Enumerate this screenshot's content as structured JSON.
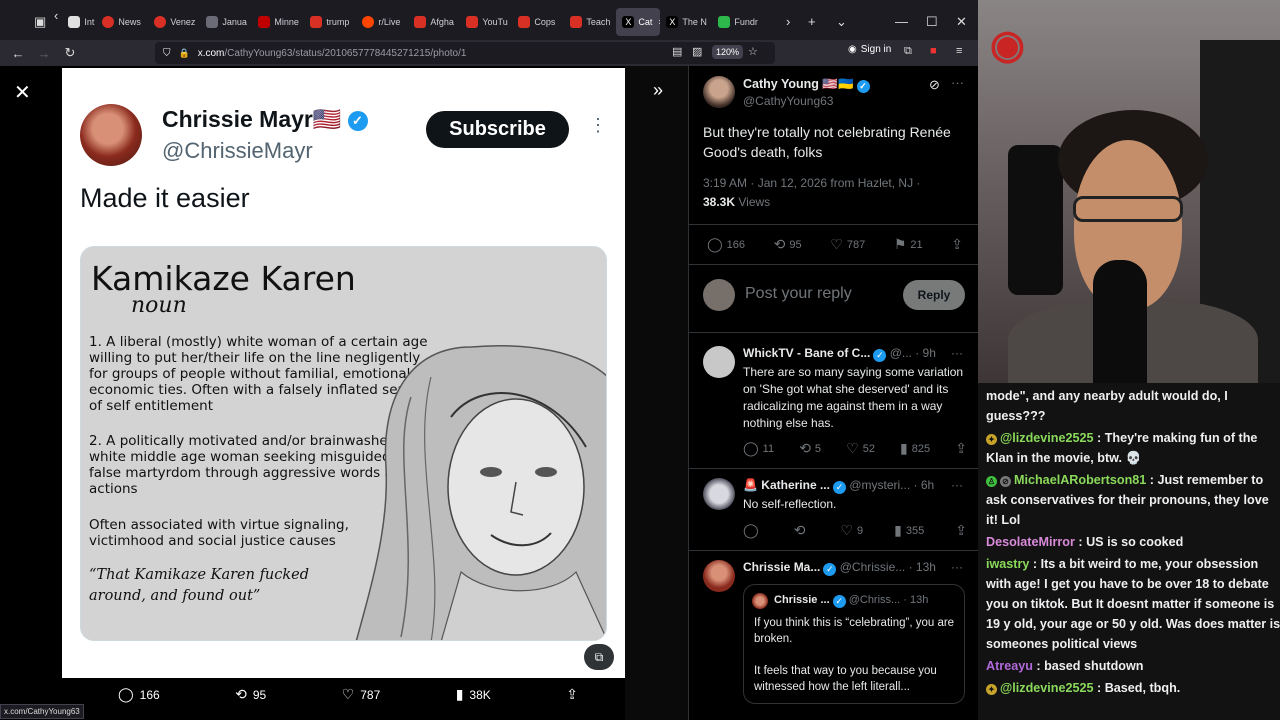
{
  "browser": {
    "tabs": [
      {
        "label": "Int",
        "color": "#e0e0e0"
      },
      {
        "label": "News",
        "color": "#d93025"
      },
      {
        "label": "Venez",
        "color": "#d93025"
      },
      {
        "label": "Janua",
        "color": "#6b6b78"
      },
      {
        "label": "Minne",
        "color": "#c00000"
      },
      {
        "label": "trump",
        "color": "#d93025"
      },
      {
        "label": "r/Live",
        "color": "#ff4500"
      },
      {
        "label": "Afgha",
        "color": "#d93025"
      },
      {
        "label": "YouTu",
        "color": "#d93025"
      },
      {
        "label": "Cops",
        "color": "#d93025"
      },
      {
        "label": "Teach",
        "color": "#d93025"
      },
      {
        "label": "Cat",
        "color": "#000000",
        "active": true
      },
      {
        "label": "The N",
        "color": "#000000"
      },
      {
        "label": "Fundr",
        "color": "#2db84b"
      }
    ],
    "url_domain": "x.com",
    "url_path": "/CathyYoung63/status/2010657778445271215/photo/1",
    "zoom": "120%",
    "signin": "Sign in",
    "status_url": "x.com/CathyYoung63"
  },
  "photo": {
    "author_name": "Chrissie Mayr🇺🇸",
    "author_handle": "@ChrissieMayr",
    "subscribe": "Subscribe",
    "text": "Made it easier",
    "meme": {
      "title": "Kamikaze Karen",
      "pos": "noun",
      "def1": "1. A liberal (mostly) white woman of a certain age willing to put her/their life on the line negligently for groups of people without familial, emotional, or economic ties. Often with a falsely inflated sense of self entitlement",
      "def2": "2. A politically motivated and/or brainwashed white middle age woman seeking misguidedly false martyrdom through aggressive words and actions",
      "assoc": "Often associated with virtue signaling, victimhood and social justice causes",
      "quote": "“That Kamikaze Karen fucked around, and found out”"
    },
    "actions": {
      "replies": "166",
      "reposts": "95",
      "likes": "787",
      "views": "38K"
    }
  },
  "tweet": {
    "author_name": "Cathy Young 🇺🇸🇺🇦",
    "author_handle": "@CathyYoung63",
    "text": "But they're totally not celebrating Renée Good's death, folks",
    "meta": "3:19 AM · Jan 12, 2026 from Hazlet, NJ ·",
    "views_count": "38.3K",
    "views_label": "Views",
    "actions": {
      "replies": "166",
      "reposts": "95",
      "likes": "787",
      "bookmarks": "21"
    },
    "reply_placeholder": "Post your reply",
    "reply_button": "Reply"
  },
  "replies": [
    {
      "name": "WhickTV - Bane of C...",
      "handle": "@...",
      "time": "· 9h",
      "text": "There are so many saying some variation on 'She got what she deserved' and its radicalizing me against them in a way nothing else has.",
      "replies": "11",
      "reposts": "5",
      "likes": "52",
      "views": "825"
    },
    {
      "name": "🚨 Katherine ...",
      "handle": "@mysteri...",
      "time": "· 6h",
      "text": "No self-reflection.",
      "replies": "",
      "reposts": "",
      "likes": "9",
      "views": "355"
    },
    {
      "name": "Chrissie Ma...",
      "handle": "@Chrissie...",
      "time": "· 13h",
      "quote_name": "Chrissie ...",
      "quote_handle": "@Chriss...",
      "quote_time": "· 13h",
      "quote_text_1": "If you think this is “celebrating”, you are broken.",
      "quote_text_2": "It feels that way to you because you witnessed how the left literall..."
    }
  ],
  "chat": [
    {
      "user": "",
      "text": "mode\", and any nearby adult would do, I guess???",
      "color": "#efeff1",
      "badges": []
    },
    {
      "user": "@lizdevine2525",
      "text": " : They're making fun of the Klan in the movie, btw. 💀",
      "color": "#8ad95a",
      "badges": [
        "#c8a32a"
      ]
    },
    {
      "user": "MichaelARobertson81",
      "text": " : Just remember to ask conservatives for their pronouns, they love it! Lol",
      "color": "#8ad95a",
      "badges": [
        "#3ec03e",
        "#777777"
      ]
    },
    {
      "user": "DesolateMirror",
      "text": " : US is so cooked",
      "color": "#d98ad9",
      "badges": []
    },
    {
      "user": "iwastry",
      "text": " : Its a bit weird to me, your obsession with age! I get you have to be over 18 to debate you on tiktok. But It doesnt matter if someone is 19 y old, your age or 50 y old. Was does matter is someones political views",
      "color": "#8ad95a",
      "badges": []
    },
    {
      "user": "Atreayu",
      "text": " : based shutdown",
      "color": "#b06ad9",
      "badges": []
    },
    {
      "user": "@lizdevine2525",
      "text": " : Based, tbqh.",
      "color": "#8ad95a",
      "badges": [
        "#c8a32a"
      ]
    }
  ]
}
